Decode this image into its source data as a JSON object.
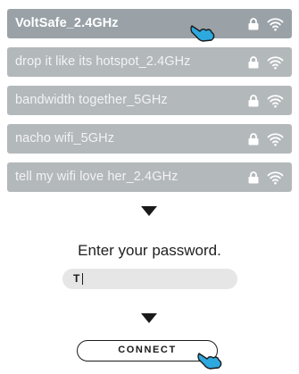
{
  "networks": [
    {
      "name": "VoltSafe_2.4GHz",
      "secured": true,
      "selected": true
    },
    {
      "name": "drop it like its hotspot_2.4GHz",
      "secured": true,
      "selected": false
    },
    {
      "name": "bandwidth together_5GHz",
      "secured": true,
      "selected": false
    },
    {
      "name": "nacho wifi_5GHz",
      "secured": true,
      "selected": false
    },
    {
      "name": "tell my wifi love her_2.4GHz",
      "secured": true,
      "selected": false
    }
  ],
  "icons": {
    "lock": "lock-icon",
    "wifi": "wifi-signal-icon",
    "pointer": "hand-pointer-icon",
    "arrow": "arrow-down-icon"
  },
  "password": {
    "prompt": "Enter your password.",
    "value": "T"
  },
  "connect_label": "CONNECT",
  "colors": {
    "row_selected": "#9aa2a8",
    "row_default": "#b3b8bb",
    "field": "#e6e6e6",
    "hand": "#2ea9df"
  }
}
